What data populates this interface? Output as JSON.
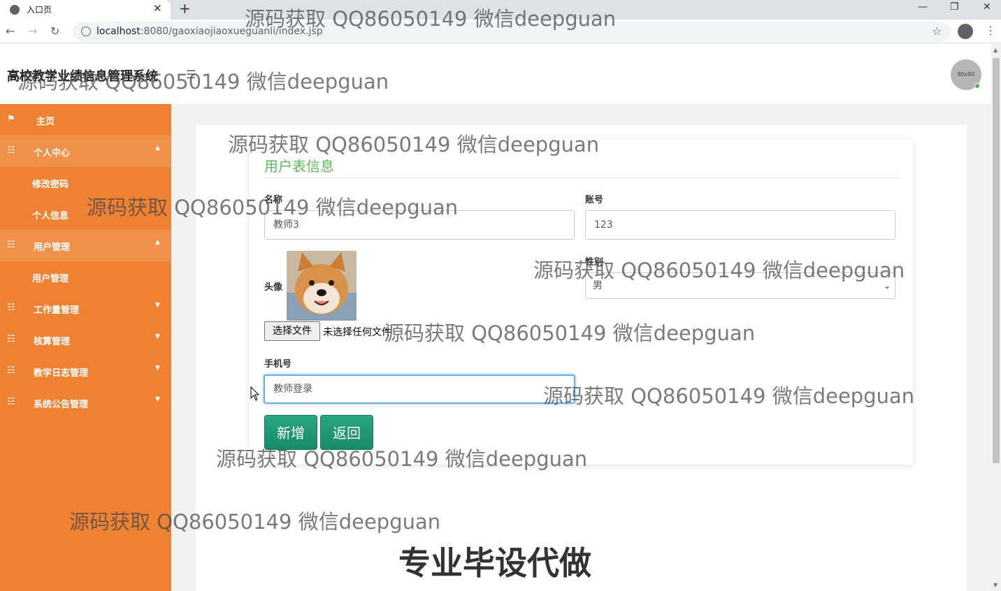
{
  "browser": {
    "tab_title": "入口页",
    "tab_close": "✕",
    "new_tab": "+",
    "url_host": "localhost",
    "url_path": ":8080/gaoxiaojiaoxueguanli/index.jsp",
    "window_controls": [
      "—",
      "❐",
      "✕"
    ]
  },
  "header": {
    "title": "高校教学业绩信息管理系统",
    "menu_toggle": "☰",
    "avatar_text": "80x80"
  },
  "sidebar": {
    "items": [
      {
        "label": "主页",
        "icon": "flag-icon",
        "level": 1
      },
      {
        "label": "个人中心",
        "icon": "grid-icon",
        "level": 1,
        "expanded": true
      },
      {
        "label": "修改密码",
        "level": 2
      },
      {
        "label": "个人信息",
        "level": 2
      },
      {
        "label": "用户管理",
        "icon": "grid-icon",
        "level": 1,
        "expanded": true
      },
      {
        "label": "用户管理",
        "level": 2
      },
      {
        "label": "工作量管理",
        "icon": "grid-icon",
        "level": 1,
        "expanded": false
      },
      {
        "label": "核算管理",
        "icon": "grid-icon",
        "level": 1,
        "expanded": false
      },
      {
        "label": "教学日志管理",
        "icon": "grid-icon",
        "level": 1,
        "expanded": false
      },
      {
        "label": "系统公告管理",
        "icon": "grid-icon",
        "level": 1,
        "expanded": false
      }
    ],
    "color": "#ee8232"
  },
  "form": {
    "title": "用户表信息",
    "name_label": "名称",
    "name_value": "教师3",
    "account_label": "账号",
    "account_value": "123",
    "avatar_label": "头像",
    "gender_label": "性别",
    "gender_value": "男",
    "file_button": "选择文件",
    "file_status": "未选择任何文件",
    "phone_label": "手机号",
    "phone_value": "教师登录",
    "add_button": "新增",
    "back_button": "返回"
  },
  "watermarks": {
    "text": "源码获取 QQ86050149 微信deepguan",
    "bottom": "专业毕设代做"
  },
  "colors": {
    "accent": "#5cb85c",
    "button": "#1d9a76"
  }
}
